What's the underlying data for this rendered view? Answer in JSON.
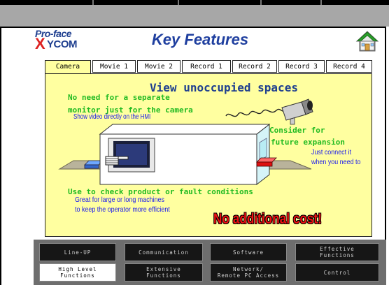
{
  "header": {
    "title": "Key Features",
    "logo_top": "Pro-face",
    "logo_x": "X",
    "logo_ycom": "YCOM"
  },
  "tabs": [
    {
      "label": "Camera",
      "active": true
    },
    {
      "label": "Movie 1"
    },
    {
      "label": "Movie 2"
    },
    {
      "label": "Record 1"
    },
    {
      "label": "Record 2"
    },
    {
      "label": "Record 3"
    },
    {
      "label": "Record 4"
    }
  ],
  "panel": {
    "headline": "View unoccupied spaces",
    "line1": "No need for a separate",
    "line2": "monitor just for the camera",
    "line3": "Show video directly on the HMI",
    "consider1": "Consider for",
    "consider2": "future expansion",
    "connect1": "Just connect it",
    "connect2": "when you need to",
    "use_line": "Use to check product or fault conditions",
    "great1": "Great for large or long machines",
    "great2": "to keep the operator more efficient",
    "no_cost": "No additional cost!"
  },
  "nav": {
    "row1": [
      {
        "label": "Line-UP"
      },
      {
        "label": "Communication"
      },
      {
        "label": "Software"
      },
      {
        "label": "Effective",
        "label2": "Functions"
      }
    ],
    "row2": [
      {
        "label": "High Level",
        "label2": "Functions",
        "active": true
      },
      {
        "label": "Extensive",
        "label2": "Functions"
      },
      {
        "label": "Network/",
        "label2": "Remote PC Access"
      },
      {
        "label": "Control"
      }
    ]
  },
  "colors": {
    "title_blue": "#1f3f9f",
    "panel_yellow": "#ffffa0",
    "green_text": "#22bb22",
    "red_text": "#ee1111",
    "nav_bg": "#161616"
  },
  "icons": {
    "home": "home-icon",
    "camera": "security-camera-icon",
    "hand": "pointing-hand-icon"
  }
}
